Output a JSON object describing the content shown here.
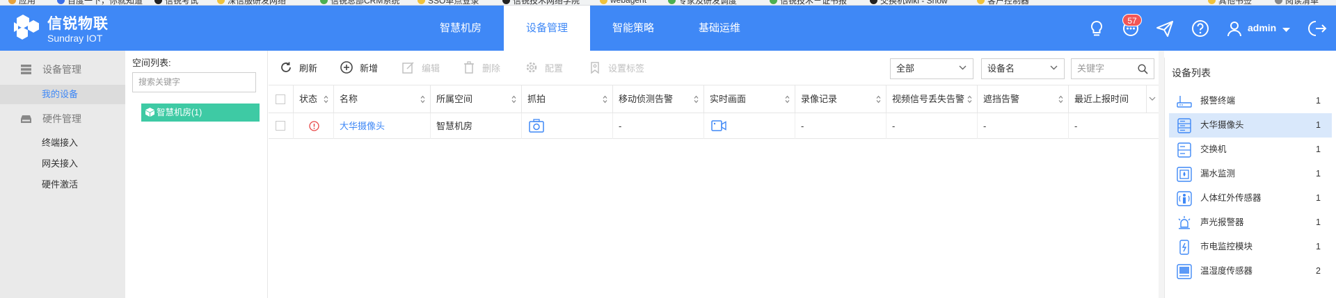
{
  "bookmarks": [
    "应用",
    "百度一下，你就知道",
    "信锐考试",
    "深信服研发网络",
    "信锐总部CRM系统",
    "SSO单点登录",
    "信锐技术网络学院",
    "webagent",
    "专家及研发调度",
    "信锐技术－证书报",
    "交换机wiki - Show",
    "客户控制器",
    "其他书签",
    "阅读清单"
  ],
  "header": {
    "brand_cn": "信锐物联",
    "brand_en": "Sundray IOT",
    "tabs": [
      {
        "label": "智慧机房",
        "active": false
      },
      {
        "label": "设备管理",
        "active": true
      },
      {
        "label": "智能策略",
        "active": false
      },
      {
        "label": "基础运维",
        "active": false
      }
    ],
    "notification_count": "57",
    "username": "admin",
    "accent_color": "#3f88f6"
  },
  "sidebar": {
    "groups": [
      {
        "label": "设备管理",
        "icon": "storage-icon",
        "items": [
          {
            "label": "我的设备",
            "active": true
          }
        ]
      },
      {
        "label": "硬件管理",
        "icon": "hardware-icon",
        "items": [
          {
            "label": "终端接入"
          },
          {
            "label": "网关接入"
          },
          {
            "label": "硬件激活"
          }
        ]
      }
    ]
  },
  "space": {
    "title": "空间列表:",
    "search_placeholder": "搜索关键字",
    "node_label": "智慧机房(1)"
  },
  "toolbar": {
    "refresh": "刷新",
    "add": "新增",
    "edit": "编辑",
    "delete": "删除",
    "config": "配置",
    "set_tag": "设置标签",
    "filter_all": "全部",
    "filter_field": "设备名",
    "keyword_placeholder": "关键字"
  },
  "table": {
    "columns": [
      "状态",
      "名称",
      "所属空间",
      "抓拍",
      "移动侦测告警",
      "实时画面",
      "录像记录",
      "视频信号丢失告警",
      "遮挡告警",
      "最近上报时间"
    ],
    "rows": [
      {
        "status": "alert",
        "name": "大华摄像头",
        "space": "智慧机房",
        "snapshot": "camera-icon",
        "motion": "-",
        "live": "video-icon",
        "record": "-",
        "signal_loss": "-",
        "cover": "-",
        "last_report": "-"
      }
    ]
  },
  "device_list": {
    "title": "设备列表",
    "items": [
      {
        "label": "报警终端",
        "count": "1",
        "icon": "alarm-terminal-icon"
      },
      {
        "label": "大华摄像头",
        "count": "1",
        "icon": "camera-server-icon",
        "active": true
      },
      {
        "label": "交换机",
        "count": "1",
        "icon": "switch-icon"
      },
      {
        "label": "漏水监测",
        "count": "1",
        "icon": "leak-monitor-icon"
      },
      {
        "label": "人体红外传感器",
        "count": "1",
        "icon": "infrared-sensor-icon"
      },
      {
        "label": "声光报警器",
        "count": "1",
        "icon": "sound-light-alarm-icon"
      },
      {
        "label": "市电监控模块",
        "count": "1",
        "icon": "power-monitor-icon"
      },
      {
        "label": "温湿度传感器",
        "count": "2",
        "icon": "temp-humidity-icon"
      }
    ]
  }
}
